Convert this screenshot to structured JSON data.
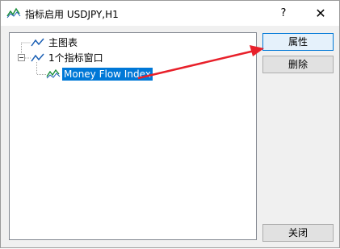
{
  "window": {
    "title": "指标启用 USDJPY,H1",
    "help_label": "?",
    "close_label": "✕"
  },
  "tree": {
    "items": [
      {
        "label": "主图表",
        "icon": "chart-line-icon",
        "expanded": false
      },
      {
        "label": "1个指标窗口",
        "icon": "chart-line-icon",
        "expanded": true
      },
      {
        "label": "Money Flow Index",
        "icon": "indicator-icon",
        "selected": true
      }
    ]
  },
  "buttons": {
    "properties": "属性",
    "delete": "删除",
    "close": "关闭"
  },
  "colors": {
    "selection": "#0078d7",
    "annotation_arrow": "#e8202a",
    "icon_line": "#1a5fb4"
  }
}
